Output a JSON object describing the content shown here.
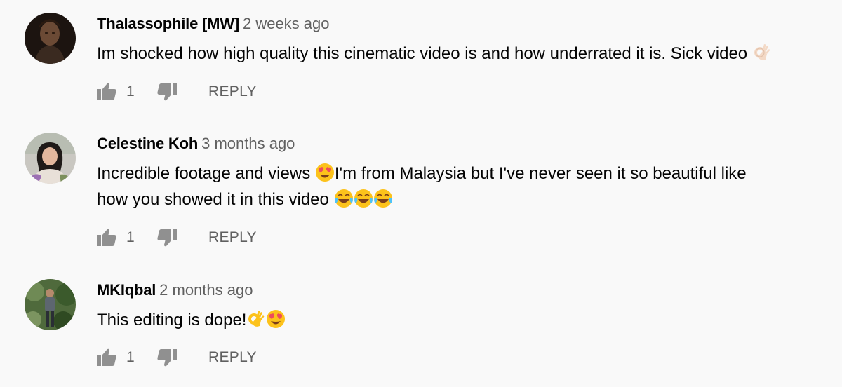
{
  "comments": [
    {
      "author": "Thalassophile [MW]",
      "time": "2 weeks ago",
      "text_line1": "Im shocked how high quality this cinematic video is and how underrated it is. Sick video",
      "like_count": "1",
      "reply_label": "REPLY",
      "emojis": [
        "ok-hand-light"
      ]
    },
    {
      "author": "Celestine Koh",
      "time": "3 months ago",
      "text_line1_a": "Incredible footage and views",
      "text_line1_b": "I'm from Malaysia but I've never seen it so beautiful like",
      "text_line2": "how you showed it in this video",
      "like_count": "1",
      "reply_label": "REPLY",
      "emojis": [
        "heart-eyes",
        "tears-of-joy",
        "tears-of-joy",
        "tears-of-joy"
      ]
    },
    {
      "author": "MKIqbal",
      "time": "2 months ago",
      "text_line1": "This editing is dope!",
      "like_count": "1",
      "reply_label": "REPLY",
      "emojis": [
        "ok-hand",
        "heart-eyes"
      ]
    }
  ],
  "colors": {
    "background": "#f9f9f9",
    "author": "#030303",
    "meta": "#606060",
    "icon": "#909090"
  }
}
